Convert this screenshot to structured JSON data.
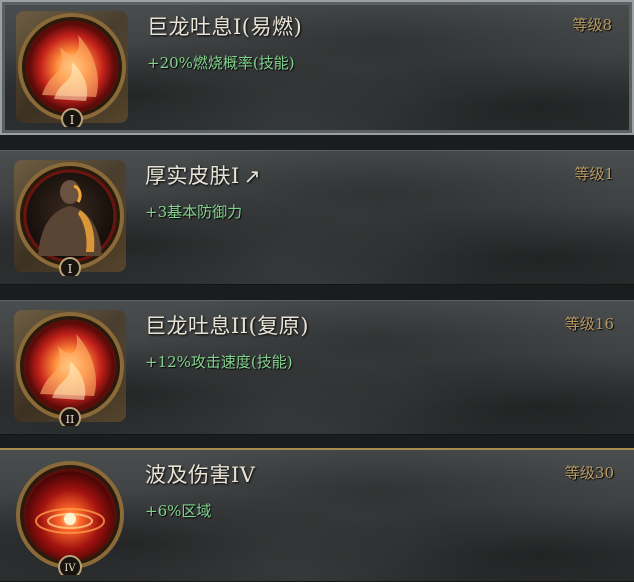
{
  "skills": [
    {
      "title": "巨龙吐息I(易燃)",
      "effect": "+20%燃烧概率(技能)",
      "level": "等级8",
      "rank": "I",
      "icon": "fire-breath-icon"
    },
    {
      "title": "厚实皮肤I",
      "effect": "+3基本防御力",
      "level": "等级1",
      "rank": "I",
      "icon": "thick-skin-icon",
      "arrow": "↗"
    },
    {
      "title": "巨龙吐息II(复原)",
      "effect": "+12%攻击速度(技能)",
      "level": "等级16",
      "rank": "II",
      "icon": "fire-breath-icon"
    },
    {
      "title": "波及伤害IV",
      "effect": "+6%区域",
      "level": "等级30",
      "rank": "IV",
      "icon": "area-blast-icon"
    }
  ],
  "colors": {
    "title": "#e9e3d6",
    "effect": "#82d38d",
    "level": "#b89a62",
    "frame_gold": "#a68a4e"
  }
}
